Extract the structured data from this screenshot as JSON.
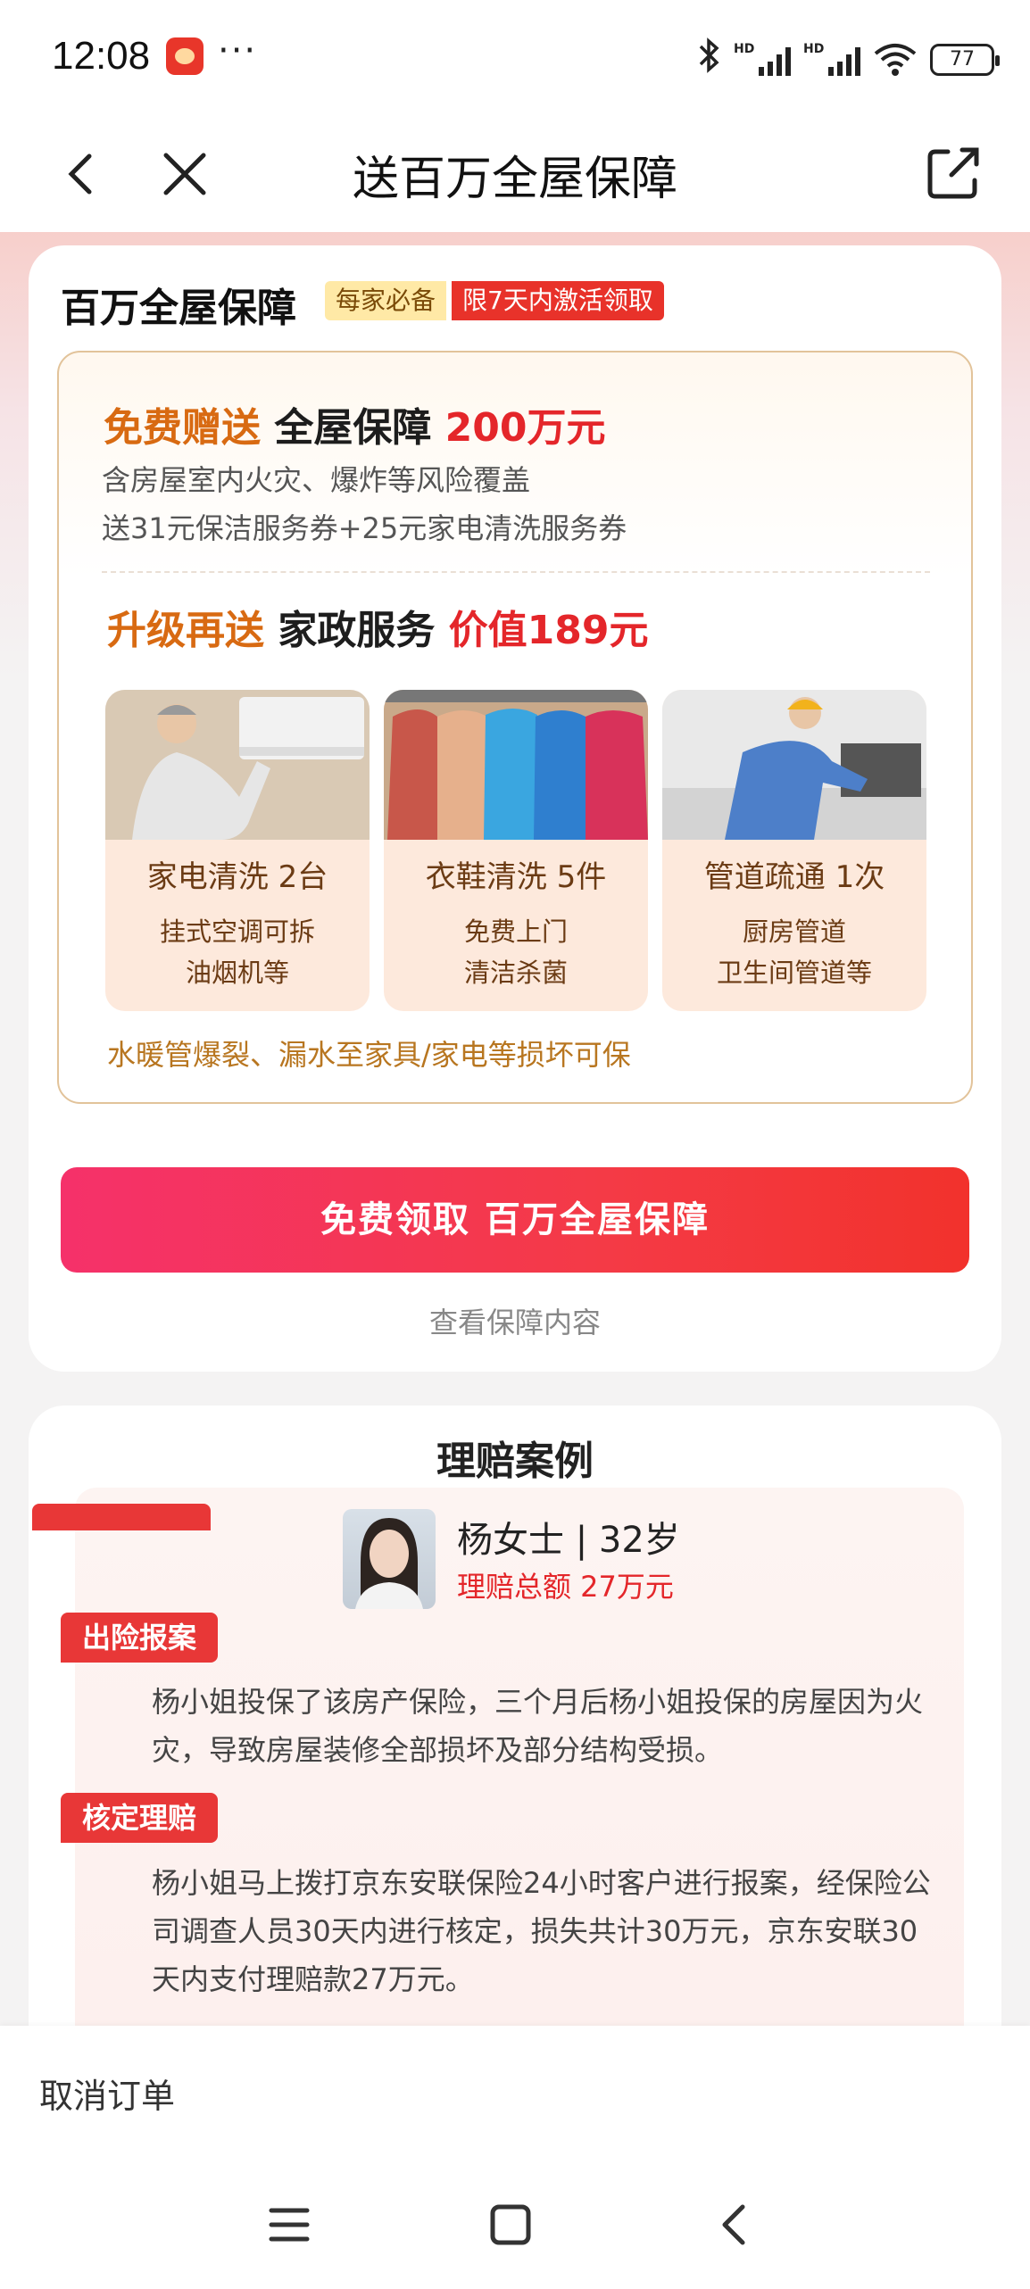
{
  "status": {
    "time": "12:08",
    "dots": "···",
    "hd1": "HD",
    "hd2": "HD",
    "battery": "77"
  },
  "nav": {
    "title": "送百万全屋保障"
  },
  "product": {
    "title": "百万全屋保障",
    "tag_must": "每家必备",
    "tag_limit": "限7天内激活领取",
    "line1_a": "免费赠送",
    "line1_b": " 全屋保障 ",
    "line1_c": "200万元",
    "desc1": "含房屋室内火灾、爆炸等风险覆盖",
    "desc2": "送31元保洁服务券+25元家电清洗服务券",
    "line2_a": "升级再送",
    "line2_b": " 家政服务 ",
    "line2_c": "价值189元",
    "services": [
      {
        "name": "家电清洗 2台",
        "d1": "挂式空调可拆",
        "d2": "油烟机等"
      },
      {
        "name": "衣鞋清洗 5件",
        "d1": "免费上门",
        "d2": "清洁杀菌"
      },
      {
        "name": "管道疏通 1次",
        "d1": "厨房管道",
        "d2": "卫生间管道等"
      }
    ],
    "note": "水暖管爆裂、漏水至家具/家电等损坏可保",
    "cta": "免费领取 百万全屋保障",
    "view_link": "查看保障内容"
  },
  "claims": {
    "title": "理赔案例",
    "person": "杨女士 | 32岁",
    "amount": "理赔总额 27万元",
    "step1_label": "出险报案",
    "step1_text": "杨小姐投保了该房产保险，三个月后杨小姐投保的房屋因为火灾，导致房屋装修全部损坏及部分结构受损。",
    "step2_label": "核定理赔",
    "step2_text": "杨小姐马上拨打京东安联保险24小时客户进行报案，经保险公司调查人员30天内进行核定，损失共计30万元，京东安联30天内支付理赔款27万元。"
  },
  "bottom": {
    "cancel": "取消订单"
  },
  "colors": {
    "accent_red": "#e4262a",
    "accent_orange": "#d86a12",
    "cta_pink": "#f5316a"
  }
}
